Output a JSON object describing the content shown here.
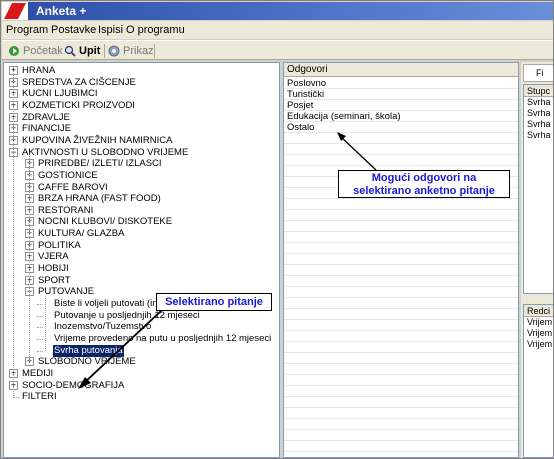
{
  "window": {
    "title": "Anketa +"
  },
  "menu": [
    "Program",
    "Postavke",
    "Ispisi",
    "O programu"
  ],
  "toolbar": {
    "start": "Početak",
    "query": "Upit",
    "view": "Prikaz"
  },
  "tree": {
    "top1": [
      "HRANA",
      "SREDSTVA ZA CIŠCENJE",
      "KUCNI LJUBIMCI",
      "KOZMETICKI PROIZVODI",
      "ZDRAVLJE",
      "FINANCIJE",
      "KUPOVINA ŽIVEŽNIH NAMIRNICA",
      "AKTIVNOSTI U SLOBODNO VRIJEME"
    ],
    "sub": [
      "PRIREDBE/ IZLETI/ IZLASCI",
      "GOSTIONICE",
      "CAFFE BAROVI",
      "BRZA HRANA (FAST FOOD)",
      "RESTORANI",
      "NOCNI KLUBOVI/ DISKOTEKE",
      "KULTURA/ GLAZBA",
      "POLITIKA",
      "VJERA",
      "HOBIJI",
      "SPORT",
      "PUTOVANJE"
    ],
    "questions": [
      "Biste li voljeli putovati (inozemstvo ili tuzemstvo)?",
      "Putovanje u posljednjih 12 mjeseci",
      "Inozemstvo/Tuzemstvo",
      "Vrijeme provedeno na putu u posljednjih 12 mjeseci",
      "Svrha putovanja"
    ],
    "sub_after": [
      "SLOBODNO VRIJEME"
    ],
    "top2": [
      "MEDIJI",
      "SOCIO-DEMOGRAFIJA",
      "FILTERI"
    ]
  },
  "answers": {
    "header": "Odgovori",
    "items": [
      "Poslovno",
      "Turistički",
      "Posjet",
      "Edukacija (seminari, škola)",
      "Ostalo"
    ]
  },
  "right_pane": {
    "tab": "Fi",
    "top_header": "Stupc",
    "top_rows": [
      "Svrha",
      "Svrha",
      "Svrha",
      "Svrha"
    ],
    "bottom_header": "Redci",
    "bottom_rows": [
      "Vrijem",
      "Vrijem",
      "Vrijem"
    ]
  },
  "callouts": {
    "answers_line1": "Mogući odgovori  na",
    "answers_line2": "selektirano anketno pitanje",
    "selected": "Selektirano pitanje"
  }
}
